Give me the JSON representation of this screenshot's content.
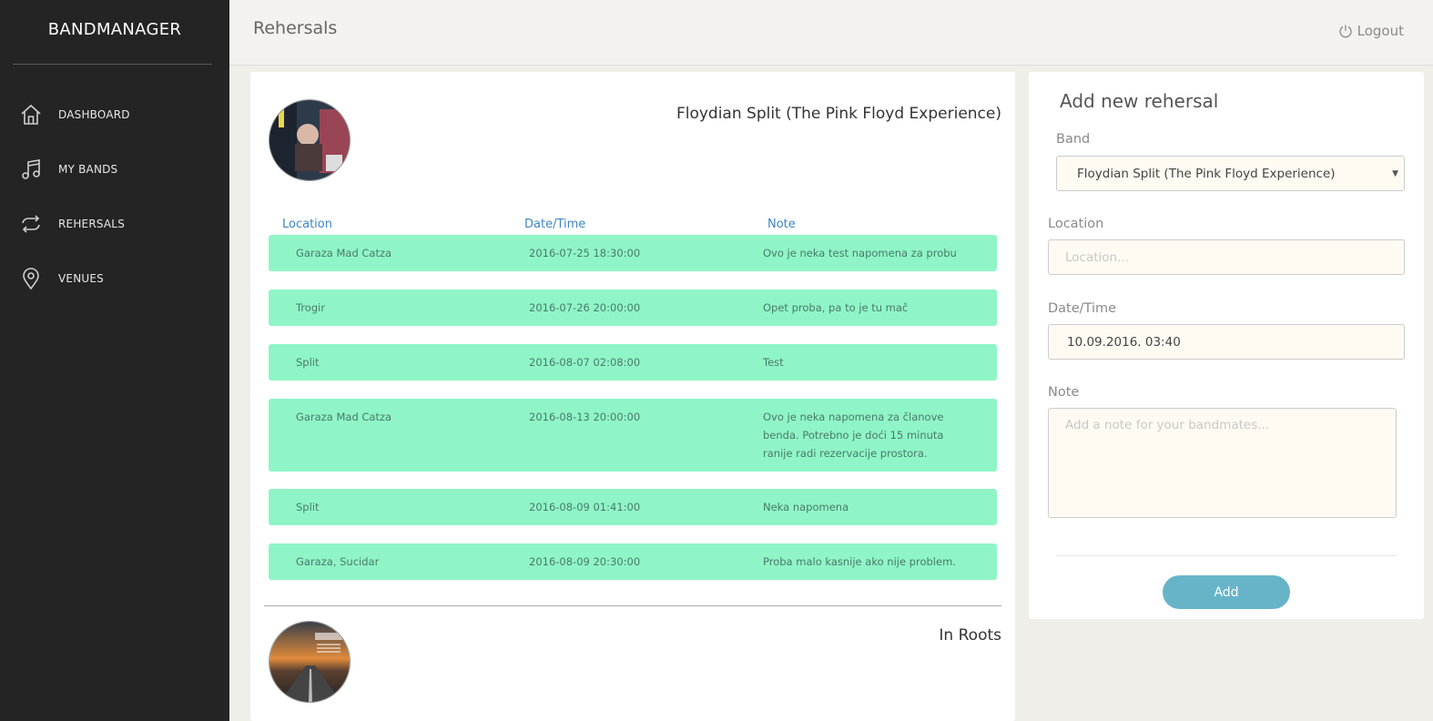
{
  "sidebar": {
    "brand": "BANDMANAGER",
    "items": [
      {
        "label": "DASHBOARD",
        "icon": "home-icon"
      },
      {
        "label": "MY BANDS",
        "icon": "music-icon"
      },
      {
        "label": "REHERSALS",
        "icon": "repeat-icon"
      },
      {
        "label": "VENUES",
        "icon": "location-pin-icon"
      }
    ]
  },
  "header": {
    "title": "Rehersals",
    "logout_label": "Logout"
  },
  "main": {
    "columns": {
      "location": "Location",
      "datetime": "Date/Time",
      "note": "Note"
    },
    "bands": [
      {
        "name": "Floydian Split (The Pink Floyd Experience)",
        "rehearsals": [
          {
            "location": "Garaza Mad Catza",
            "datetime": "2016-07-25 18:30:00",
            "note": "Ovo je neka test napomena za probu"
          },
          {
            "location": "Trogir",
            "datetime": "2016-07-26 20:00:00",
            "note": "Opet proba, pa to je tu mač"
          },
          {
            "location": "Split",
            "datetime": "2016-08-07 02:08:00",
            "note": "Test"
          },
          {
            "location": "Garaza Mad Catza",
            "datetime": "2016-08-13 20:00:00",
            "note": "Ovo je neka napomena za članove benda. Potrebno je doći 15 minuta ranije radi rezervacije prostora."
          },
          {
            "location": "Split",
            "datetime": "2016-08-09 01:41:00",
            "note": "Neka napomena"
          },
          {
            "location": "Garaza, Sucidar",
            "datetime": "2016-08-09 20:30:00",
            "note": "Proba malo kasnije ako nije problem."
          }
        ]
      },
      {
        "name": "In Roots",
        "rehearsals": []
      }
    ]
  },
  "form": {
    "title": "Add new rehersal",
    "band_label": "Band",
    "band_value": "Floydian Split (The Pink Floyd Experience)",
    "location_label": "Location",
    "location_placeholder": "Location...",
    "datetime_label": "Date/Time",
    "datetime_value": "10.09.2016. 03:40",
    "note_label": "Note",
    "note_placeholder": "Add a note for your bandmates...",
    "add_label": "Add"
  },
  "colors": {
    "sidebar_bg": "#242424",
    "row_bg": "#8ff5c7",
    "column_header": "#3d86c6",
    "add_button": "#67b4c9",
    "input_bg": "#fffbf3"
  }
}
